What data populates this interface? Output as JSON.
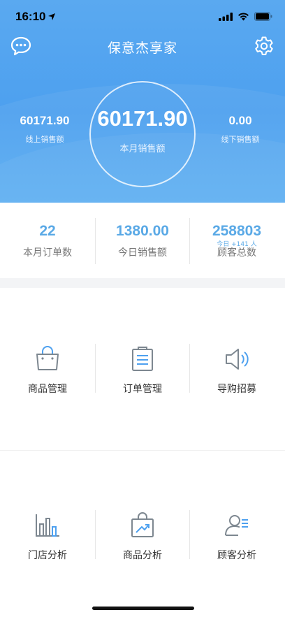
{
  "status_bar": {
    "time": "16:10"
  },
  "header": {
    "title": "保意杰享家",
    "monthly_sales_value": "60171.90",
    "monthly_sales_label": "本月销售额",
    "online_sales_value": "60171.90",
    "online_sales_label": "线上销售额",
    "offline_sales_value": "0.00",
    "offline_sales_label": "线下销售额"
  },
  "stats": [
    {
      "value": "22",
      "label": "本月订单数"
    },
    {
      "value": "1380.00",
      "label": "今日销售额"
    },
    {
      "value": "258803",
      "sub": "今日 +141 人",
      "label": "顾客总数"
    }
  ],
  "menu": [
    {
      "label": "商品管理",
      "icon": "shopping-bag-icon"
    },
    {
      "label": "订单管理",
      "icon": "clipboard-list-icon"
    },
    {
      "label": "导购招募",
      "icon": "speaker-icon"
    },
    {
      "label": "门店分析",
      "icon": "bar-chart-icon"
    },
    {
      "label": "商品分析",
      "icon": "bag-trend-icon"
    },
    {
      "label": "顾客分析",
      "icon": "user-list-icon"
    }
  ],
  "colors": {
    "primary": "#4da0ef",
    "accent_text": "#5aa9e6"
  }
}
